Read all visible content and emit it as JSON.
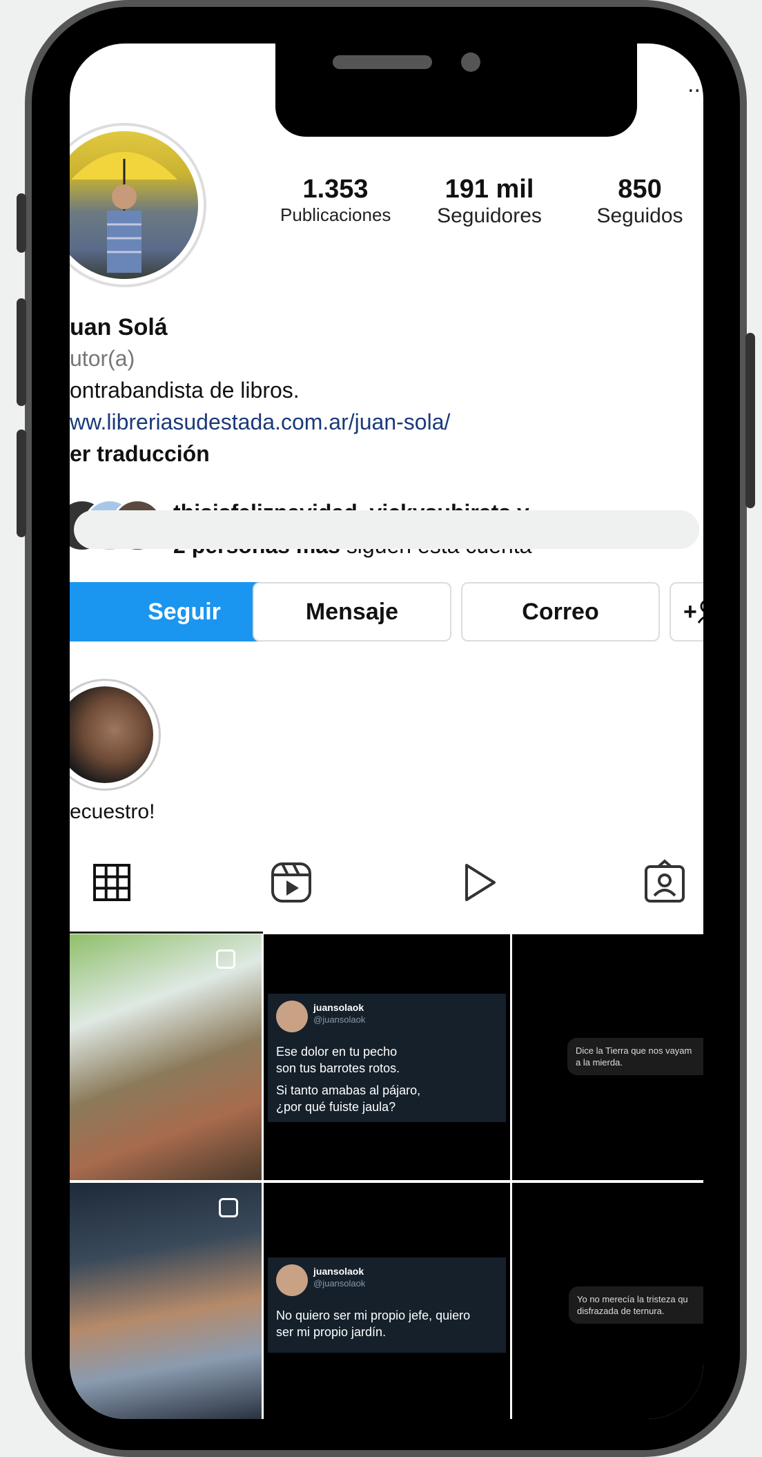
{
  "profile": {
    "handle": "juansolaok",
    "more": "...",
    "stats": [
      {
        "value": "1.353",
        "label": "Publicaciones"
      },
      {
        "value": "191 mil",
        "label": "Seguidores"
      },
      {
        "value": "850",
        "label": "Seguidos"
      }
    ],
    "name": "uan Solá",
    "category": "utor(a)",
    "bio": "ontrabandista de libros.",
    "link": "ww.libreriasudestada.com.ar/juan-sola/",
    "translate": "er traducción",
    "followed_by_names": "thisisfeliznavidad, vickysubirats y",
    "followed_by_more": "2 personas más",
    "followed_by_rest": "siguen esta cuenta"
  },
  "actions": {
    "follow": "Seguir",
    "message": "Mensaje",
    "email": "Correo",
    "add_user": "+"
  },
  "highlight": {
    "label": "ecuestro!"
  },
  "tabs": [
    "grid-icon",
    "reels-icon",
    "video-icon",
    "tagged-icon"
  ],
  "posts": {
    "tweet1": {
      "name": "juansolaok",
      "handle": "@juansolaok",
      "line1": "Ese dolor en tu pecho",
      "line2": "son tus barrotes rotos.",
      "line3": "Si tanto amabas al pájaro,",
      "line4": "¿por qué fuiste jaula?"
    },
    "bubble1_l1": "Dice la Tierra que nos vayam",
    "bubble1_l2": "a la mierda.",
    "tweet2": {
      "name": "juansolaok",
      "handle": "@juansolaok",
      "line1": "No quiero ser mi propio jefe, quiero",
      "line2": "ser mi propio jardín."
    },
    "bubble2_l1": "Yo no merecía la tristeza qu",
    "bubble2_l2": "disfrazada de ternura."
  },
  "colors": {
    "accent": "#1a95f0",
    "link": "#1b3a7a"
  }
}
